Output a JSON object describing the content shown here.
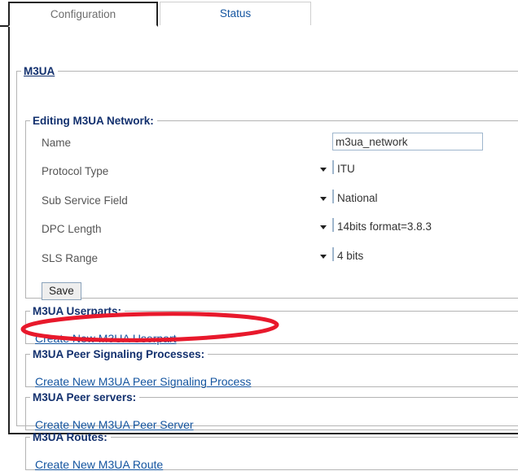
{
  "tabs": [
    {
      "label": "Configuration",
      "active": true
    },
    {
      "label": "Status",
      "active": false
    }
  ],
  "panel": {
    "legend": "M3UA",
    "sections": {
      "editing": {
        "legend": "Editing M3UA Network:",
        "fields": [
          {
            "label": "Name",
            "type": "text",
            "value": "m3ua_network",
            "placeholder": ""
          },
          {
            "label": "Protocol Type",
            "type": "select",
            "value": "ITU"
          },
          {
            "label": "Sub Service Field",
            "type": "select",
            "value": "National"
          },
          {
            "label": "DPC Length",
            "type": "select",
            "value": "14bits format=3.8.3"
          },
          {
            "label": "SLS Range",
            "type": "select",
            "value": "4 bits"
          }
        ],
        "save_label": "Save"
      },
      "userparts": {
        "legend": "M3UA Userparts:",
        "link": "Create New M3UA Userpart"
      },
      "peer_signaling_processes": {
        "legend": "M3UA Peer Signaling Processes:",
        "link": "Create New M3UA Peer Signaling Process"
      },
      "peer_servers": {
        "legend": "M3UA Peer servers:",
        "link": "Create New M3UA Peer Server"
      },
      "routes": {
        "legend": "M3UA Routes:",
        "link": "Create New M3UA Route"
      }
    }
  },
  "annotation": {
    "shape": "ellipse-highlight",
    "color": "#e8192c",
    "target": "Create New M3UA Peer Signaling Process"
  },
  "colors": {
    "link": "#1455a0",
    "legend": "#12306e",
    "label": "#555555",
    "border": "#b4b4b4",
    "tab_border": "#222222",
    "annotation": "#e8192c"
  }
}
